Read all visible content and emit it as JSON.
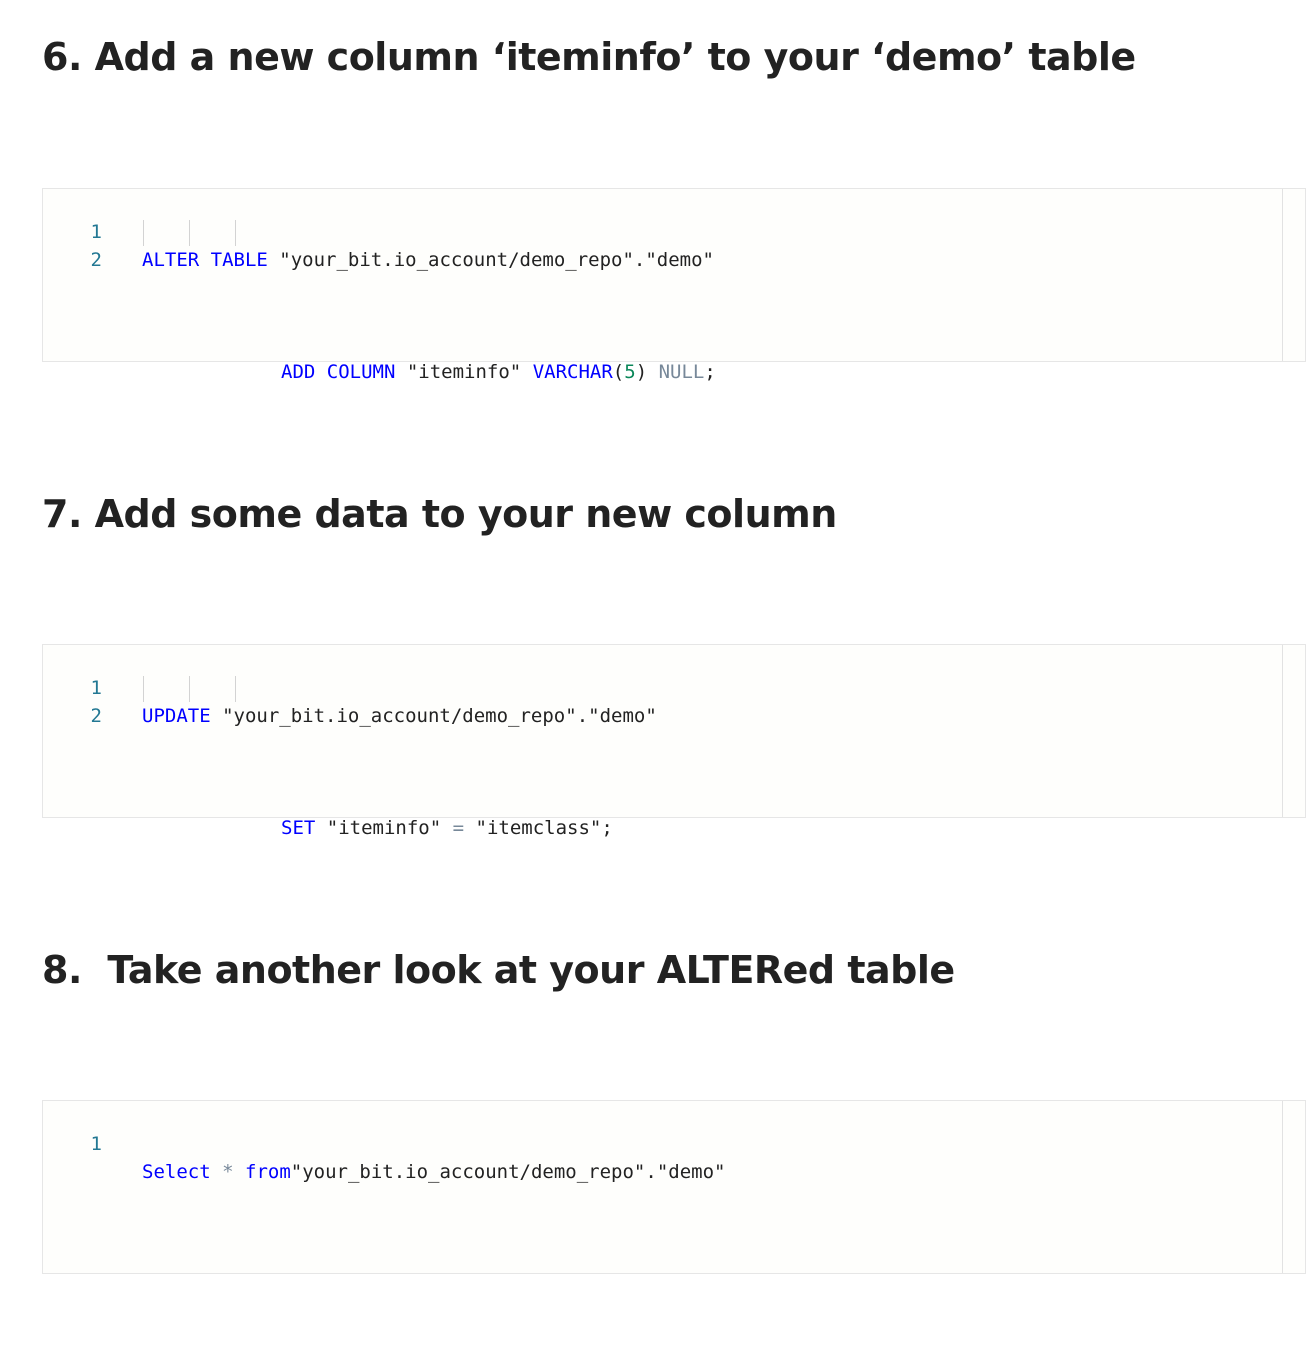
{
  "sections": [
    {
      "heading": "6. Add a new column ‘iteminfo’ to your ‘demo’ table",
      "editor": {
        "line_numbers": [
          "1",
          "2"
        ],
        "lines": [
          [
            {
              "text": "ALTER",
              "type": "kw"
            },
            {
              "text": " ",
              "type": "pl"
            },
            {
              "text": "TABLE",
              "type": "kw"
            },
            {
              "text": " \"your_bit.io_account/demo_repo\".\"demo\"",
              "type": "str"
            }
          ],
          [
            {
              "text": "ADD",
              "type": "kw"
            },
            {
              "text": " ",
              "type": "pl"
            },
            {
              "text": "COLUMN",
              "type": "kw"
            },
            {
              "text": " \"iteminfo\" ",
              "type": "str"
            },
            {
              "text": "VARCHAR",
              "type": "kw"
            },
            {
              "text": "(",
              "type": "pl"
            },
            {
              "text": "5",
              "type": "num"
            },
            {
              "text": ") ",
              "type": "pl"
            },
            {
              "text": "NULL",
              "type": "nul"
            },
            {
              "text": ";",
              "type": "pl"
            }
          ]
        ]
      }
    },
    {
      "heading": "7. Add some data to your new column",
      "editor": {
        "line_numbers": [
          "1",
          "2"
        ],
        "lines": [
          [
            {
              "text": "UPDATE",
              "type": "kw"
            },
            {
              "text": " \"your_bit.io_account/demo_repo\".\"demo\"",
              "type": "str"
            }
          ],
          [
            {
              "text": "SET",
              "type": "kw"
            },
            {
              "text": " \"iteminfo\" ",
              "type": "str"
            },
            {
              "text": "=",
              "type": "op"
            },
            {
              "text": " \"itemclass\";",
              "type": "str"
            }
          ]
        ]
      }
    },
    {
      "heading": "8.  Take another look at your ALTERed table",
      "editor": {
        "line_numbers": [
          "1"
        ],
        "lines": [
          [
            {
              "text": "Select",
              "type": "kw"
            },
            {
              "text": " ",
              "type": "pl"
            },
            {
              "text": "*",
              "type": "op"
            },
            {
              "text": " ",
              "type": "pl"
            },
            {
              "text": "from",
              "type": "kw"
            },
            {
              "text": "\"your_bit.io_account/demo_repo\".\"demo\"",
              "type": "str"
            }
          ]
        ]
      }
    }
  ],
  "colors": {
    "keyword": "#0000ff",
    "number": "#098658",
    "operator": "#778899",
    "line_number": "#237893",
    "heading": "#222222"
  }
}
